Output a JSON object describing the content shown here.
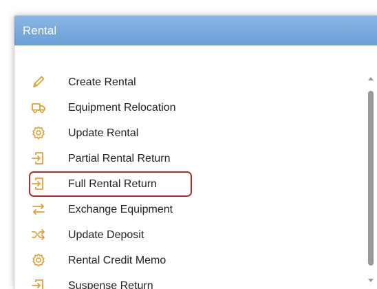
{
  "panel": {
    "title": "Rental",
    "items": [
      {
        "label": "Create Rental",
        "icon": "pencil-icon"
      },
      {
        "label": "Equipment Relocation",
        "icon": "truck-icon"
      },
      {
        "label": "Update Rental",
        "icon": "gear-icon"
      },
      {
        "label": "Partial Rental Return",
        "icon": "return-icon"
      },
      {
        "label": "Full Rental Return",
        "icon": "return-icon"
      },
      {
        "label": "Exchange Equipment",
        "icon": "exchange-arrows-icon"
      },
      {
        "label": "Update Deposit",
        "icon": "shuffle-icon"
      },
      {
        "label": "Rental Credit Memo",
        "icon": "gear-icon"
      },
      {
        "label": "Suspense Return",
        "icon": "return-icon"
      }
    ]
  },
  "colors": {
    "header": "#7aaddf",
    "icon": "#e0a030",
    "highlight": "#b22a2a",
    "scroll_thumb": "#9a9a9a"
  },
  "highlighted_item": "Full Rental Return"
}
